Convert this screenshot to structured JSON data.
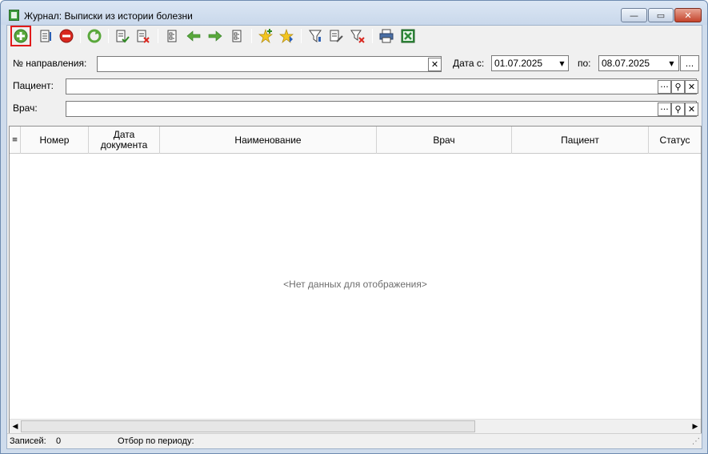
{
  "window": {
    "title": "Журнал: Выписки из истории болезни",
    "buttons": {
      "minimize": "—",
      "maximize": "▭",
      "close": "✕"
    }
  },
  "toolbar": {
    "icons": [
      "add-icon",
      "edit-icon",
      "delete-icon",
      "refresh-icon",
      "approve-icon",
      "reject-icon",
      "move-left-doc-icon",
      "arrow-left-icon",
      "arrow-right-icon",
      "move-right-doc-icon",
      "favorite-add-icon",
      "favorite-icon",
      "filter-icon",
      "filter-edit-icon",
      "filter-clear-icon",
      "print-icon",
      "excel-icon"
    ],
    "selected": "add-icon"
  },
  "filters": {
    "direction_label": "№ направления:",
    "direction_value": "",
    "date_from_label": "Дата с:",
    "date_from_value": "01.07.2025",
    "date_to_label": "по:",
    "date_to_value": "08.07.2025",
    "patient_label": "Пациент:",
    "patient_value": "",
    "doctor_label": "Врач:",
    "doctor_value": "",
    "ellipsis": "...",
    "dots": "···"
  },
  "grid": {
    "columns": [
      "Номер",
      "Дата документа",
      "Наименование",
      "Врач",
      "Пациент",
      "Статус"
    ],
    "empty_text": "<Нет данных для отображения>"
  },
  "status": {
    "records_label": "Записей:",
    "records_value": "0",
    "period_label": "Отбор по периоду:"
  },
  "colors": {
    "accent_green": "#5aa83c",
    "delete_red": "#d9271f",
    "selection_border": "#e11b1b",
    "title_bg": "#cfdcec"
  }
}
